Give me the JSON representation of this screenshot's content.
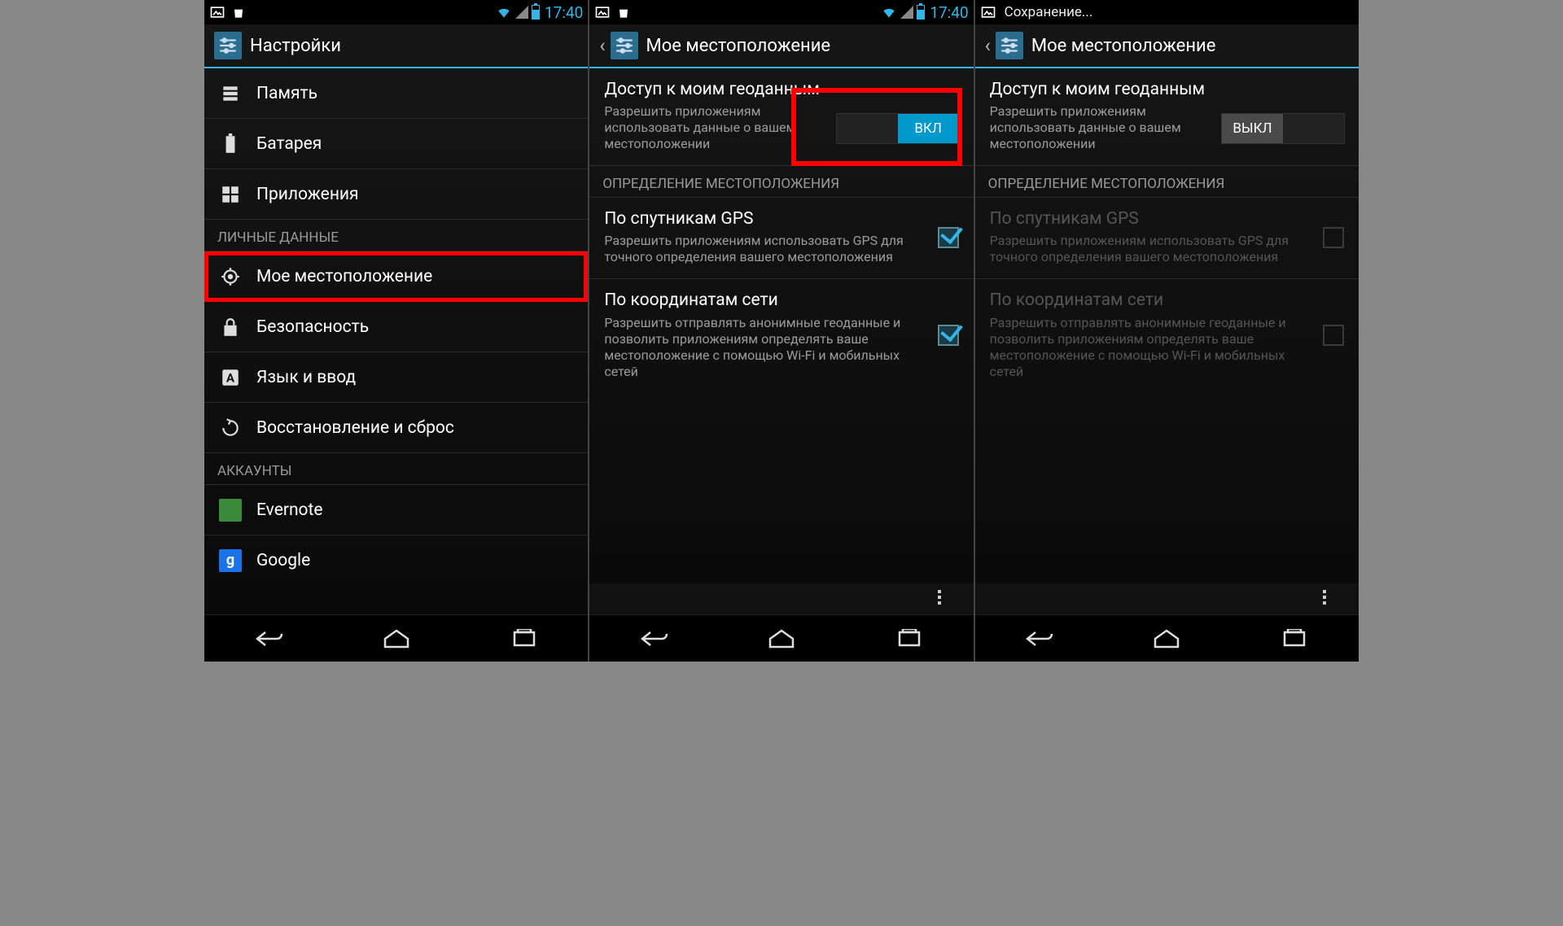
{
  "status": {
    "time": "17:40",
    "saving": "Сохранение..."
  },
  "screen1": {
    "title": "Настройки",
    "items": [
      {
        "label": "Память"
      },
      {
        "label": "Батарея"
      },
      {
        "label": "Приложения"
      }
    ],
    "cat_personal": "ЛИЧНЫЕ ДАННЫЕ",
    "personal": [
      {
        "label": "Мое местоположение"
      },
      {
        "label": "Безопасность"
      },
      {
        "label": "Язык и ввод"
      },
      {
        "label": "Восстановление и сброс"
      }
    ],
    "cat_accounts": "АККАУНТЫ",
    "accounts": [
      {
        "label": "Evernote"
      },
      {
        "label": "Google"
      }
    ]
  },
  "screen2": {
    "title": "Мое местоположение",
    "access_title": "Доступ к моим геоданным",
    "access_sub": "Разрешить приложениям использовать данные о вашем местоположении",
    "toggle_on": "ВКЛ",
    "section": "ОПРЕДЕЛЕНИЕ МЕСТОПОЛОЖЕНИЯ",
    "gps_title": "По спутникам GPS",
    "gps_sub": "Разрешить приложениям использовать GPS для точного определения вашего местоположения",
    "net_title": "По координатам сети",
    "net_sub": "Разрешить отправлять анонимные геоданные и позволить приложениям определять ваше местоположение с помощью Wi-Fi и мобильных сетей"
  },
  "screen3": {
    "title": "Мое местоположение",
    "access_title": "Доступ к моим геоданным",
    "access_sub": "Разрешить приложениям использовать данные о вашем местоположении",
    "toggle_off": "ВЫКЛ",
    "section": "ОПРЕДЕЛЕНИЕ МЕСТОПОЛОЖЕНИЯ",
    "gps_title": "По спутникам GPS",
    "gps_sub": "Разрешить приложениям использовать GPS для точного определения вашего местоположения",
    "net_title": "По координатам сети",
    "net_sub": "Разрешить отправлять анонимные геоданные и позволить приложениям определять ваше местоположение с помощью Wi-Fi и мобильных сетей"
  }
}
